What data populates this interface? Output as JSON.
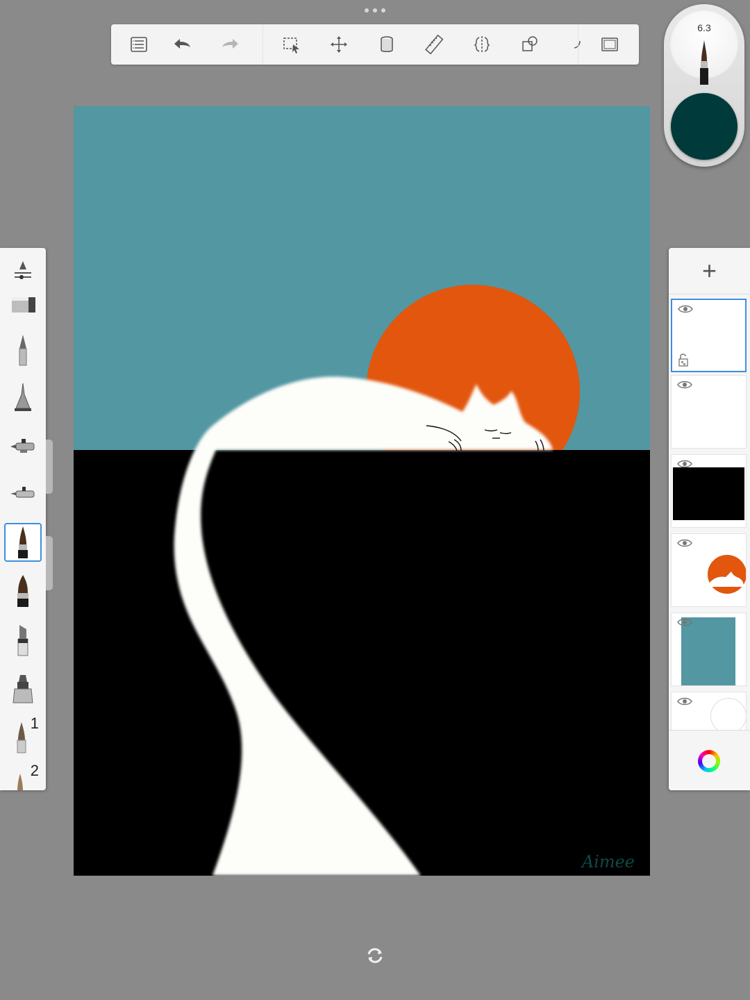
{
  "app": {
    "accent": "#3b8fe0",
    "background": "#8a8a8a"
  },
  "toolbar": {
    "buttons": [
      {
        "icon": "list-icon"
      },
      {
        "icon": "undo-icon"
      },
      {
        "icon": "redo-icon"
      },
      {
        "icon": "selection-icon"
      },
      {
        "icon": "transform-icon"
      },
      {
        "icon": "fill-bucket-icon"
      },
      {
        "icon": "ruler-icon"
      },
      {
        "icon": "symmetry-icon"
      },
      {
        "icon": "shapes-icon"
      },
      {
        "icon": "perspective-icon"
      },
      {
        "icon": "fullscreen-icon"
      }
    ]
  },
  "brush_puck": {
    "size_value": "6.3",
    "current_color": "#003a3a"
  },
  "canvas": {
    "sky_color": "#5297a1",
    "ground_color": "#000000",
    "sun_color": "#e2560e",
    "cat_color": "#fdfdf9",
    "signature": "Aimee"
  },
  "brush_palette": {
    "items": [
      {
        "icon": "brush-properties-icon"
      },
      {
        "icon": "eraser-brush-icon"
      },
      {
        "icon": "pencil-brush-icon"
      },
      {
        "icon": "ballpoint-brush-icon"
      },
      {
        "icon": "airbrush-icon"
      },
      {
        "icon": "airbrush-fine-icon"
      },
      {
        "icon": "paintbrush-icon",
        "selected": true
      },
      {
        "icon": "paintbrush-wide-icon"
      },
      {
        "icon": "marker-icon"
      },
      {
        "icon": "chisel-marker-icon"
      },
      {
        "icon": "custom-brush-icon",
        "number": "1"
      },
      {
        "icon": "custom-brush-icon",
        "number": "2"
      }
    ]
  },
  "layers": {
    "add_label": "+",
    "items": [
      {
        "name": "signature-layer",
        "active": true
      },
      {
        "name": "lines-layer"
      },
      {
        "name": "ground-layer"
      },
      {
        "name": "sun-cat-layer"
      },
      {
        "name": "sky-layer"
      },
      {
        "name": "background-layer"
      }
    ]
  }
}
